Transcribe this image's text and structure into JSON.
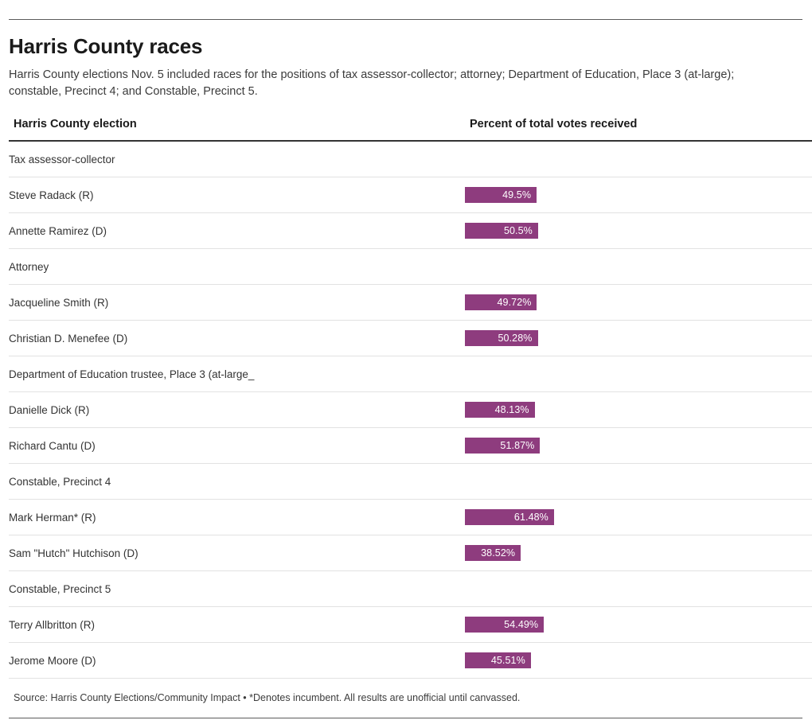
{
  "header": {
    "title": "Harris County races",
    "subtitle": "Harris County elections Nov. 5 included races for the positions of tax assessor-collector; attorney; Department of Education, Place 3 (at-large); constable, Precinct 4; and Constable, Precinct 5."
  },
  "table": {
    "columns": [
      "Harris County election",
      "Percent of total votes received"
    ],
    "rows": [
      {
        "label": "Tax assessor-collector",
        "type": "group",
        "value": null,
        "value_label": ""
      },
      {
        "label": "Steve Radack (R)",
        "type": "candidate",
        "value": 49.5,
        "value_label": "49.5%"
      },
      {
        "label": "Annette Ramirez (D)",
        "type": "candidate",
        "value": 50.5,
        "value_label": "50.5%"
      },
      {
        "label": "Attorney",
        "type": "group",
        "value": null,
        "value_label": ""
      },
      {
        "label": "Jacqueline Smith (R)",
        "type": "candidate",
        "value": 49.72,
        "value_label": "49.72%"
      },
      {
        "label": "Christian D. Menefee (D)",
        "type": "candidate",
        "value": 50.28,
        "value_label": "50.28%"
      },
      {
        "label": "Department of Education trustee, Place 3 (at-large_",
        "type": "group",
        "value": null,
        "value_label": ""
      },
      {
        "label": "Danielle Dick (R)",
        "type": "candidate",
        "value": 48.13,
        "value_label": "48.13%"
      },
      {
        "label": "Richard Cantu (D)",
        "type": "candidate",
        "value": 51.87,
        "value_label": "51.87%"
      },
      {
        "label": "Constable, Precinct 4",
        "type": "group",
        "value": null,
        "value_label": ""
      },
      {
        "label": "Mark Herman* (R)",
        "type": "candidate",
        "value": 61.48,
        "value_label": "61.48%"
      },
      {
        "label": "Sam \"Hutch\" Hutchison (D)",
        "type": "candidate",
        "value": 38.52,
        "value_label": "38.52%"
      },
      {
        "label": "Constable, Precinct 5",
        "type": "group",
        "value": null,
        "value_label": ""
      },
      {
        "label": "Terry Allbritton (R)",
        "type": "candidate",
        "value": 54.49,
        "value_label": "54.49%"
      },
      {
        "label": "Jerome Moore (D)",
        "type": "candidate",
        "value": 45.51,
        "value_label": "45.51%"
      }
    ]
  },
  "footer": {
    "source": "Source: Harris County Elections/Community Impact • *Denotes incumbent. All results are unofficial until canvassed."
  },
  "style": {
    "bar_color": "#8e3c7e",
    "bar_label_color": "#ffffff",
    "rule_color": "#5b5b5b",
    "row_divider_color": "#e2e2e2"
  },
  "chart_data": {
    "type": "bar",
    "title": "Harris County races",
    "subtitle": "Harris County elections Nov. 5 included races for the positions of tax assessor-collector; attorney; Department of Education, Place 3 (at-large); constable, Precinct 4; and Constable, Precinct 5.",
    "xlabel": "Percent of total votes received",
    "ylabel": "Harris County election",
    "orientation": "horizontal",
    "xlim": [
      0,
      100
    ],
    "grid": false,
    "legend": null,
    "value_suffix": "%",
    "groups": [
      {
        "name": "Tax assessor-collector",
        "categories": [
          "Steve Radack (R)",
          "Annette Ramirez (D)"
        ],
        "values": [
          49.5,
          50.5
        ],
        "value_labels": [
          "49.5%",
          "50.5%"
        ]
      },
      {
        "name": "Attorney",
        "categories": [
          "Jacqueline Smith (R)",
          "Christian D. Menefee (D)"
        ],
        "values": [
          49.72,
          50.28
        ],
        "value_labels": [
          "49.72%",
          "50.28%"
        ]
      },
      {
        "name": "Department of Education trustee, Place 3 (at-large_",
        "categories": [
          "Danielle Dick (R)",
          "Richard Cantu (D)"
        ],
        "values": [
          48.13,
          51.87
        ],
        "value_labels": [
          "48.13%",
          "51.87%"
        ]
      },
      {
        "name": "Constable, Precinct 4",
        "categories": [
          "Mark Herman* (R)",
          "Sam \"Hutch\" Hutchison (D)"
        ],
        "values": [
          61.48,
          38.52
        ],
        "value_labels": [
          "61.48%",
          "38.52%"
        ]
      },
      {
        "name": "Constable, Precinct 5",
        "categories": [
          "Terry Allbritton (R)",
          "Jerome Moore (D)"
        ],
        "values": [
          54.49,
          45.51
        ],
        "value_labels": [
          "54.49%",
          "45.51%"
        ]
      }
    ],
    "categories": [
      "Steve Radack (R)",
      "Annette Ramirez (D)",
      "Jacqueline Smith (R)",
      "Christian D. Menefee (D)",
      "Danielle Dick (R)",
      "Richard Cantu (D)",
      "Mark Herman* (R)",
      "Sam \"Hutch\" Hutchison (D)",
      "Terry Allbritton (R)",
      "Jerome Moore (D)"
    ],
    "values": [
      49.5,
      50.5,
      49.72,
      50.28,
      48.13,
      51.87,
      61.48,
      38.52,
      54.49,
      45.51
    ],
    "series": [
      {
        "name": "Percent of total votes received",
        "color": "#8e3c7e",
        "values": [
          49.5,
          50.5,
          49.72,
          50.28,
          48.13,
          51.87,
          61.48,
          38.52,
          54.49,
          45.51
        ]
      }
    ],
    "source": "Source: Harris County Elections/Community Impact • *Denotes incumbent. All results are unofficial until canvassed."
  }
}
